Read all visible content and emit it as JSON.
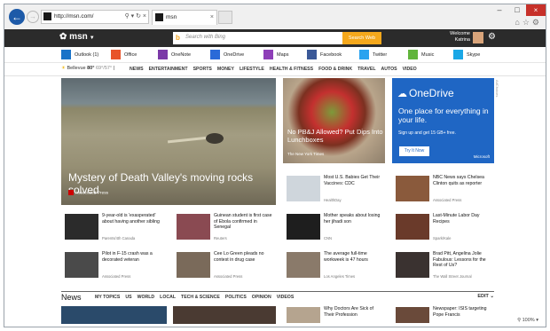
{
  "browser": {
    "url": "http://msn.com/",
    "tab_title": "msn"
  },
  "msn": {
    "logo": "msn",
    "search_placeholder": "Search with Bing",
    "search_button": "Search Web",
    "welcome_line1": "Welcome",
    "welcome_line2": "Katrina"
  },
  "apps": [
    {
      "label": "Outlook (1)",
      "color": "#1a73c8"
    },
    {
      "label": "Office",
      "color": "#e8542a"
    },
    {
      "label": "OneNote",
      "color": "#7b3aa8"
    },
    {
      "label": "OneDrive",
      "color": "#2a6ad8"
    },
    {
      "label": "Maps",
      "color": "#8e3fb8"
    },
    {
      "label": "Facebook",
      "color": "#3b5998"
    },
    {
      "label": "Twitter",
      "color": "#2aa3ef"
    },
    {
      "label": "Music",
      "color": "#61b53c"
    },
    {
      "label": "Skype",
      "color": "#1aa7e6"
    }
  ],
  "weather": {
    "city": "Bellevue",
    "temp": "80°",
    "hilo": "69°/57°"
  },
  "nav": [
    "NEWS",
    "ENTERTAINMENT",
    "SPORTS",
    "MONEY",
    "LIFESTYLE",
    "HEALTH & FITNESS",
    "FOOD & DRINK",
    "TRAVEL",
    "AUTOS",
    "VIDEO"
  ],
  "hero": {
    "caption": "Mystery of Death Valley's moving rocks solved",
    "source": "Associated Press"
  },
  "story2": {
    "caption": "No PB&J Allowed? Put Dips Into Lunchboxes",
    "source": "The New York Times"
  },
  "onedrive": {
    "logo": "OneDrive",
    "headline": "One place for everything in your life.",
    "sub": "Sign up and get 15 GB+ free.",
    "button": "Try It Now",
    "brand": "Microsoft",
    "ad_label": "AdChoices"
  },
  "cards": [
    {
      "title": "Most U.S. Babies Get Their Vaccines: CDC",
      "source": "HealthDay",
      "color": "#cfd6dc"
    },
    {
      "title": "NBC News says Chelsea Clinton quits as reporter",
      "source": "Associated Press",
      "color": "#8a5a3c"
    },
    {
      "title": "9-year-old is 'exasperated' about having another sibling",
      "source": "Parents/4th Canada",
      "color": "#2b2b2b"
    },
    {
      "title": "Guinean student is first case of Ebola confirmed in Senegal",
      "source": "Reuters",
      "color": "#8a4a52"
    },
    {
      "title": "Mother speaks about losing her jihadi son",
      "source": "CNN",
      "color": "#1e1e1e"
    },
    {
      "title": "Last-Minute Labor Day Recipes",
      "source": "Spark/Kale",
      "color": "#6a3a2a"
    },
    {
      "title": "Pilot in F-15 crash was a decorated veteran",
      "source": "Associated Press",
      "color": "#4a4a4a"
    },
    {
      "title": "Cee Lo Green pleads no contest in drug case",
      "source": "Associated Press",
      "color": "#7a6a5a"
    },
    {
      "title": "The average full-time workweek is 47 hours",
      "source": "Los Angeles Times",
      "color": "#8a7a6a"
    },
    {
      "title": "Brad Pitt, Angelina Jolie Fabulous: Lessons for the Rest of Us?",
      "source": "The Wall Street Journal",
      "color": "#3a3230"
    }
  ],
  "news_section": {
    "title": "News",
    "items": [
      "MY TOPICS",
      "US",
      "WORLD",
      "LOCAL",
      "TECH & SCIENCE",
      "POLITICS",
      "OPINION",
      "VIDEOS"
    ],
    "edit": "EDIT"
  },
  "bottom_cards": [
    {
      "title": "Why Doctors Are Sick of Their Profession",
      "color": "#b5a48f"
    },
    {
      "title": "Newspaper: ISIS targeting Pope Francis",
      "color": "#6a4a3a"
    }
  ],
  "zoom": "100%"
}
